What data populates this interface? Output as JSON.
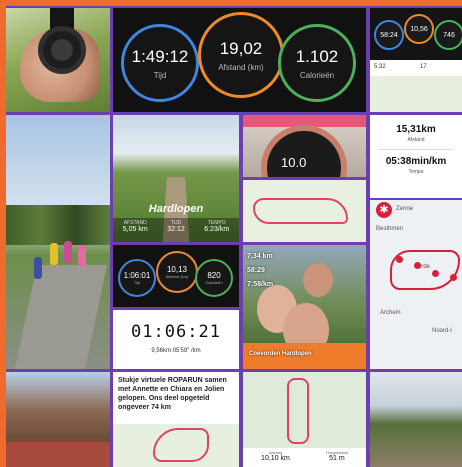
{
  "stats_main": {
    "time_value": "1:49:12",
    "time_label": "Tijd",
    "distance_value": "19,02",
    "distance_label": "Afstand (km)",
    "calories_value": "1.102",
    "calories_label": "Calorieën"
  },
  "stats_mini": {
    "time_value": "58:24",
    "distance_value": "10,56",
    "calories_value": "746",
    "stat_left": "5:32",
    "stat_right": "17"
  },
  "run_card": {
    "title": "Hardlopen",
    "distance_label": "AFSTAND",
    "distance_value": "5,05 km",
    "time_label": "TIJD",
    "time_value": "32:12",
    "tempo_label": "TEMPO",
    "tempo_value": "6:23/km"
  },
  "watch_display": "10.0",
  "tempo_card": {
    "distance_value": "15,31km",
    "distance_label": "Afstand",
    "pace_value": "05:38min/km",
    "pace_label": "Tempo"
  },
  "map_place": {
    "places": [
      "Zenne",
      "Besthmen",
      "Eerde",
      "Archem",
      "Noord-l"
    ]
  },
  "stats_small": {
    "time_value": "1:06:01",
    "time_label": "Tijd",
    "distance_value": "10,13",
    "distance_label": "Afstand (km)",
    "calories_value": "820",
    "calories_label": "Calorieën"
  },
  "selfie": {
    "line1": "7,34 km",
    "line2": "58:29",
    "line3": "7:58/km",
    "caption": "Coevorden Hardlopen"
  },
  "timer_card": {
    "time": "01:06:21",
    "distance": "9,56km",
    "pace": "05'59\" /km"
  },
  "post_text": "Stukje virtuele ROPARUN samen met Annette en Chiara en Jolien gelopen. Ons deel opgeteld ongeveer 74 km",
  "map_card": {
    "distance_label": "Afstand",
    "distance_value": "10,10 km",
    "elevation_label": "Hoogtewinst",
    "elevation_value": "51 m"
  }
}
